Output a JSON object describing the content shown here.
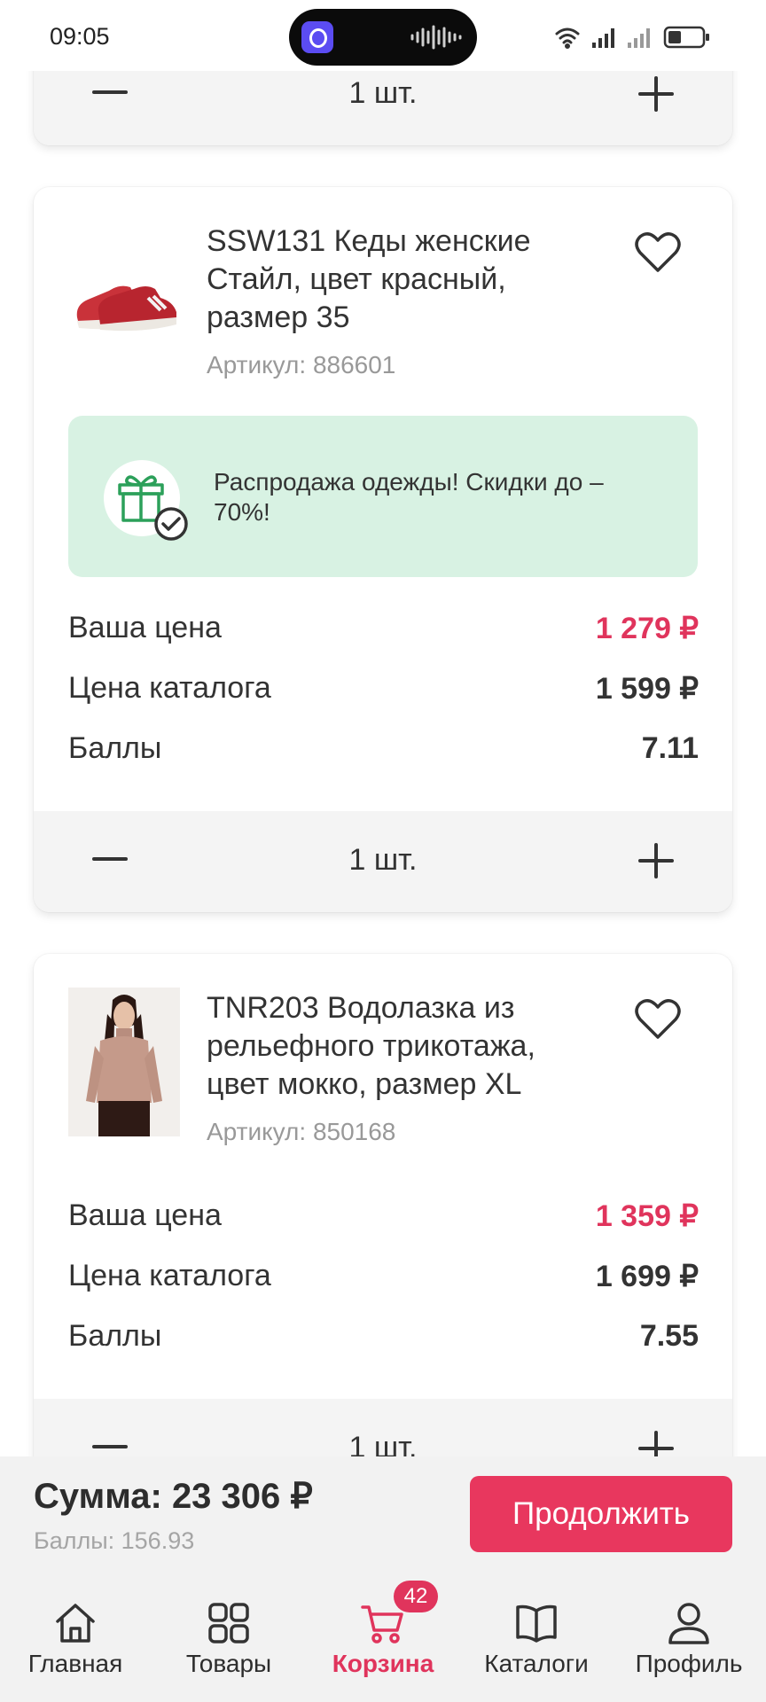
{
  "status_bar": {
    "time": "09:05"
  },
  "cart_items": [
    {
      "quantity_label": "1 шт."
    },
    {
      "title": "SSW131 Кеды женские Стайл, цвет красный, размер 35",
      "sku": "Артикул: 886601",
      "promo": "Распродажа одежды! Скидки до –70%!",
      "your_price_label": "Ваша цена",
      "your_price": "1 279 ₽",
      "catalog_price_label": "Цена каталога",
      "catalog_price": "1 599 ₽",
      "points_label": "Баллы",
      "points": "7.11",
      "quantity_label": "1 шт."
    },
    {
      "title": "TNR203 Водолазка из рельефного трикотажа, цвет мокко, размер XL",
      "sku": "Артикул: 850168",
      "your_price_label": "Ваша цена",
      "your_price": "1 359 ₽",
      "catalog_price_label": "Цена каталога",
      "catalog_price": "1 699 ₽",
      "points_label": "Баллы",
      "points": "7.55",
      "quantity_label": "1 шт."
    }
  ],
  "summary": {
    "sum": "Сумма: 23 306 ₽",
    "points": "Баллы: 156.93",
    "continue_label": "Продолжить"
  },
  "nav": {
    "items": [
      {
        "label": "Главная",
        "icon": "home-icon"
      },
      {
        "label": "Товары",
        "icon": "grid-icon"
      },
      {
        "label": "Корзина",
        "icon": "cart-icon",
        "active": true
      },
      {
        "label": "Каталоги",
        "icon": "book-icon"
      },
      {
        "label": "Профиль",
        "icon": "user-icon"
      }
    ],
    "cart_badge": "42"
  },
  "colors": {
    "accent": "#e0345c",
    "button": "#e8375e",
    "promo_bg": "#d8f2e3",
    "promo_icon": "#2ca05a"
  }
}
